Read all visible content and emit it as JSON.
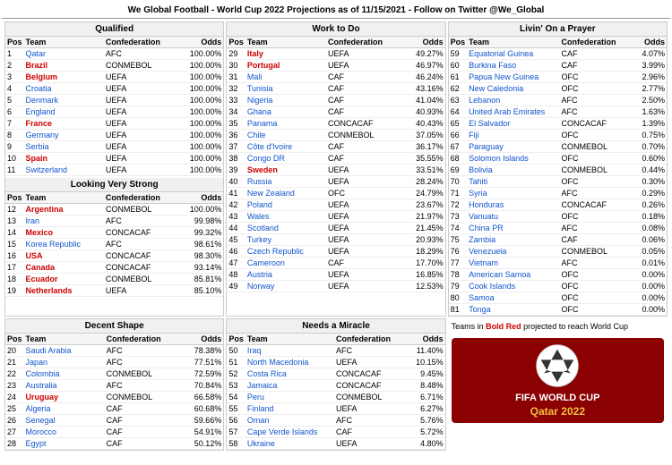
{
  "title": "We Global Football - World Cup 2022 Projections as of 11/15/2021 - Follow on Twitter @We_Global",
  "sections": {
    "qualified": {
      "header": "Qualified",
      "columns": [
        "Pos",
        "Team",
        "Confederation",
        "Odds"
      ],
      "rows": [
        {
          "pos": "1",
          "team": "Qatar",
          "conf": "AFC",
          "odds": "100.00%",
          "style": "link"
        },
        {
          "pos": "2",
          "team": "Brazil",
          "conf": "CONMEBOL",
          "odds": "100.00%",
          "style": "bold_red"
        },
        {
          "pos": "3",
          "team": "Belgium",
          "conf": "UEFA",
          "odds": "100.00%",
          "style": "bold_red"
        },
        {
          "pos": "4",
          "team": "Croatia",
          "conf": "UEFA",
          "odds": "100.00%",
          "style": "link"
        },
        {
          "pos": "5",
          "team": "Denmark",
          "conf": "UEFA",
          "odds": "100.00%",
          "style": "link"
        },
        {
          "pos": "6",
          "team": "England",
          "conf": "UEFA",
          "odds": "100.00%",
          "style": "link"
        },
        {
          "pos": "7",
          "team": "France",
          "conf": "UEFA",
          "odds": "100.00%",
          "style": "bold_red"
        },
        {
          "pos": "8",
          "team": "Germany",
          "conf": "UEFA",
          "odds": "100.00%",
          "style": "link"
        },
        {
          "pos": "9",
          "team": "Serbia",
          "conf": "UEFA",
          "odds": "100.00%",
          "style": "link"
        },
        {
          "pos": "10",
          "team": "Spain",
          "conf": "UEFA",
          "odds": "100.00%",
          "style": "bold_red"
        },
        {
          "pos": "11",
          "team": "Switzerland",
          "conf": "UEFA",
          "odds": "100.00%",
          "style": "link"
        }
      ]
    },
    "looking_strong": {
      "header": "Looking Very Strong",
      "columns": [
        "Pos",
        "Team",
        "Confederation",
        "Odds"
      ],
      "rows": [
        {
          "pos": "12",
          "team": "Argentina",
          "conf": "CONMEBOL",
          "odds": "100.00%",
          "style": "bold_red"
        },
        {
          "pos": "13",
          "team": "Iran",
          "conf": "AFC",
          "odds": "99.98%",
          "style": "link"
        },
        {
          "pos": "14",
          "team": "Mexico",
          "conf": "CONCACAF",
          "odds": "99.32%",
          "style": "bold_red"
        },
        {
          "pos": "15",
          "team": "Korea Republic",
          "conf": "AFC",
          "odds": "98.61%",
          "style": "link"
        },
        {
          "pos": "16",
          "team": "USA",
          "conf": "CONCACAF",
          "odds": "98.30%",
          "style": "bold_red"
        },
        {
          "pos": "17",
          "team": "Canada",
          "conf": "CONCACAF",
          "odds": "93.14%",
          "style": "bold_red"
        },
        {
          "pos": "18",
          "team": "Ecuador",
          "conf": "CONMEBOL",
          "odds": "85.81%",
          "style": "bold_red"
        },
        {
          "pos": "19",
          "team": "Netherlands",
          "conf": "UEFA",
          "odds": "85.10%",
          "style": "bold_red"
        }
      ]
    },
    "work_to_do": {
      "header": "Work to Do",
      "columns": [
        "Pos",
        "Team",
        "Confederation",
        "Odds"
      ],
      "rows": [
        {
          "pos": "29",
          "team": "Italy",
          "conf": "UEFA",
          "odds": "49.27%",
          "style": "bold_red"
        },
        {
          "pos": "30",
          "team": "Portugal",
          "conf": "UEFA",
          "odds": "46.97%",
          "style": "bold_red"
        },
        {
          "pos": "31",
          "team": "Mali",
          "conf": "CAF",
          "odds": "46.24%",
          "style": "link"
        },
        {
          "pos": "32",
          "team": "Tunisia",
          "conf": "CAF",
          "odds": "43.16%",
          "style": "link"
        },
        {
          "pos": "33",
          "team": "Nigeria",
          "conf": "CAF",
          "odds": "41.04%",
          "style": "link"
        },
        {
          "pos": "34",
          "team": "Ghana",
          "conf": "CAF",
          "odds": "40.93%",
          "style": "link"
        },
        {
          "pos": "35",
          "team": "Panama",
          "conf": "CONCACAF",
          "odds": "40.43%",
          "style": "link"
        },
        {
          "pos": "36",
          "team": "Chile",
          "conf": "CONMEBOL",
          "odds": "37.05%",
          "style": "link"
        },
        {
          "pos": "37",
          "team": "Côte d'Ivoire",
          "conf": "CAF",
          "odds": "36.17%",
          "style": "link"
        },
        {
          "pos": "38",
          "team": "Congo DR",
          "conf": "CAF",
          "odds": "35.55%",
          "style": "link"
        },
        {
          "pos": "39",
          "team": "Sweden",
          "conf": "UEFA",
          "odds": "33.51%",
          "style": "bold_red"
        },
        {
          "pos": "40",
          "team": "Russia",
          "conf": "UEFA",
          "odds": "28.24%",
          "style": "link"
        },
        {
          "pos": "41",
          "team": "New Zealand",
          "conf": "OFC",
          "odds": "24.79%",
          "style": "link"
        },
        {
          "pos": "42",
          "team": "Poland",
          "conf": "UEFA",
          "odds": "23.67%",
          "style": "link"
        },
        {
          "pos": "43",
          "team": "Wales",
          "conf": "UEFA",
          "odds": "21.97%",
          "style": "link"
        },
        {
          "pos": "44",
          "team": "Scotland",
          "conf": "UEFA",
          "odds": "21.45%",
          "style": "link"
        },
        {
          "pos": "45",
          "team": "Turkey",
          "conf": "UEFA",
          "odds": "20.93%",
          "style": "link"
        },
        {
          "pos": "46",
          "team": "Czech Republic",
          "conf": "UEFA",
          "odds": "18.29%",
          "style": "link"
        },
        {
          "pos": "47",
          "team": "Cameroon",
          "conf": "CAF",
          "odds": "17.70%",
          "style": "link"
        },
        {
          "pos": "48",
          "team": "Austria",
          "conf": "UEFA",
          "odds": "16.85%",
          "style": "link"
        },
        {
          "pos": "49",
          "team": "Norway",
          "conf": "UEFA",
          "odds": "12.53%",
          "style": "link"
        }
      ]
    },
    "livin_prayer": {
      "header": "Livin' On a Prayer",
      "columns": [
        "Pos",
        "Team",
        "Confederation",
        "Odds"
      ],
      "rows": [
        {
          "pos": "59",
          "team": "Equatorial Guinea",
          "conf": "CAF",
          "odds": "4.07%",
          "style": "link"
        },
        {
          "pos": "60",
          "team": "Burkina Faso",
          "conf": "CAF",
          "odds": "3.99%",
          "style": "link"
        },
        {
          "pos": "61",
          "team": "Papua New Guinea",
          "conf": "OFC",
          "odds": "2.96%",
          "style": "link"
        },
        {
          "pos": "62",
          "team": "New Caledonia",
          "conf": "OFC",
          "odds": "2.77%",
          "style": "link"
        },
        {
          "pos": "63",
          "team": "Lebanon",
          "conf": "AFC",
          "odds": "2.50%",
          "style": "link"
        },
        {
          "pos": "64",
          "team": "United Arab Emirates",
          "conf": "AFC",
          "odds": "1.63%",
          "style": "link"
        },
        {
          "pos": "65",
          "team": "El Salvador",
          "conf": "CONCACAF",
          "odds": "1.39%",
          "style": "link"
        },
        {
          "pos": "66",
          "team": "Fiji",
          "conf": "OFC",
          "odds": "0.75%",
          "style": "link"
        },
        {
          "pos": "67",
          "team": "Paraguay",
          "conf": "CONMEBOL",
          "odds": "0.70%",
          "style": "link"
        },
        {
          "pos": "68",
          "team": "Solomon Islands",
          "conf": "OFC",
          "odds": "0.60%",
          "style": "link"
        },
        {
          "pos": "69",
          "team": "Bolivia",
          "conf": "CONMEBOL",
          "odds": "0.44%",
          "style": "link"
        },
        {
          "pos": "70",
          "team": "Tahiti",
          "conf": "OFC",
          "odds": "0.30%",
          "style": "link"
        },
        {
          "pos": "71",
          "team": "Syria",
          "conf": "AFC",
          "odds": "0.29%",
          "style": "link"
        },
        {
          "pos": "72",
          "team": "Honduras",
          "conf": "CONCACAF",
          "odds": "0.26%",
          "style": "link"
        },
        {
          "pos": "73",
          "team": "Vanuatu",
          "conf": "OFC",
          "odds": "0.18%",
          "style": "link"
        },
        {
          "pos": "74",
          "team": "China PR",
          "conf": "AFC",
          "odds": "0.08%",
          "style": "link"
        },
        {
          "pos": "75",
          "team": "Zambia",
          "conf": "CAF",
          "odds": "0.06%",
          "style": "link"
        },
        {
          "pos": "76",
          "team": "Venezuela",
          "conf": "CONMEBOL",
          "odds": "0.05%",
          "style": "link"
        },
        {
          "pos": "77",
          "team": "Vietnam",
          "conf": "AFC",
          "odds": "0.01%",
          "style": "link"
        },
        {
          "pos": "78",
          "team": "American Samoa",
          "conf": "OFC",
          "odds": "0.00%",
          "style": "link"
        },
        {
          "pos": "79",
          "team": "Cook Islands",
          "conf": "OFC",
          "odds": "0.00%",
          "style": "link"
        },
        {
          "pos": "80",
          "team": "Samoa",
          "conf": "OFC",
          "odds": "0.00%",
          "style": "link"
        },
        {
          "pos": "81",
          "team": "Tonga",
          "conf": "OFC",
          "odds": "0.00%",
          "style": "link"
        }
      ]
    },
    "decent_shape": {
      "header": "Decent Shape",
      "columns": [
        "Pos",
        "Team",
        "Confederation",
        "Odds"
      ],
      "rows": [
        {
          "pos": "20",
          "team": "Saudi Arabia",
          "conf": "AFC",
          "odds": "78.38%",
          "style": "link"
        },
        {
          "pos": "21",
          "team": "Japan",
          "conf": "AFC",
          "odds": "77.51%",
          "style": "link"
        },
        {
          "pos": "22",
          "team": "Colombia",
          "conf": "CONMEBOL",
          "odds": "72.59%",
          "style": "link"
        },
        {
          "pos": "23",
          "team": "Australia",
          "conf": "AFC",
          "odds": "70.84%",
          "style": "link"
        },
        {
          "pos": "24",
          "team": "Uruguay",
          "conf": "CONMEBOL",
          "odds": "66.58%",
          "style": "bold_red"
        },
        {
          "pos": "25",
          "team": "Algeria",
          "conf": "CAF",
          "odds": "60.68%",
          "style": "link"
        },
        {
          "pos": "26",
          "team": "Senegal",
          "conf": "CAF",
          "odds": "59.66%",
          "style": "link"
        },
        {
          "pos": "27",
          "team": "Morocco",
          "conf": "CAF",
          "odds": "54.91%",
          "style": "link"
        },
        {
          "pos": "28",
          "team": "Egypt",
          "conf": "CAF",
          "odds": "50.12%",
          "style": "link"
        }
      ]
    },
    "needs_miracle": {
      "header": "Needs a Miracle",
      "columns": [
        "Pos",
        "Team",
        "Confederation",
        "Odds"
      ],
      "rows": [
        {
          "pos": "50",
          "team": "Iraq",
          "conf": "AFC",
          "odds": "11.40%",
          "style": "link"
        },
        {
          "pos": "51",
          "team": "North Macedonia",
          "conf": "UEFA",
          "odds": "10.15%",
          "style": "link"
        },
        {
          "pos": "52",
          "team": "Costa Rica",
          "conf": "CONCACAF",
          "odds": "9.45%",
          "style": "link"
        },
        {
          "pos": "53",
          "team": "Jamaica",
          "conf": "CONCACAF",
          "odds": "8.48%",
          "style": "link"
        },
        {
          "pos": "54",
          "team": "Peru",
          "conf": "CONMEBOL",
          "odds": "6.71%",
          "style": "link"
        },
        {
          "pos": "55",
          "team": "Finland",
          "conf": "UEFA",
          "odds": "6.27%",
          "style": "link"
        },
        {
          "pos": "56",
          "team": "Oman",
          "conf": "AFC",
          "odds": "5.76%",
          "style": "link"
        },
        {
          "pos": "57",
          "team": "Cape Verde Islands",
          "conf": "CAF",
          "odds": "5.72%",
          "style": "link"
        },
        {
          "pos": "58",
          "team": "Ukraine",
          "conf": "UEFA",
          "odds": "4.80%",
          "style": "link"
        }
      ]
    }
  },
  "note": "Teams in Bold Red projected to reach World Cup",
  "logo": {
    "line1": "FIFA WORLD CUP",
    "line2": "Qatar 2022"
  }
}
